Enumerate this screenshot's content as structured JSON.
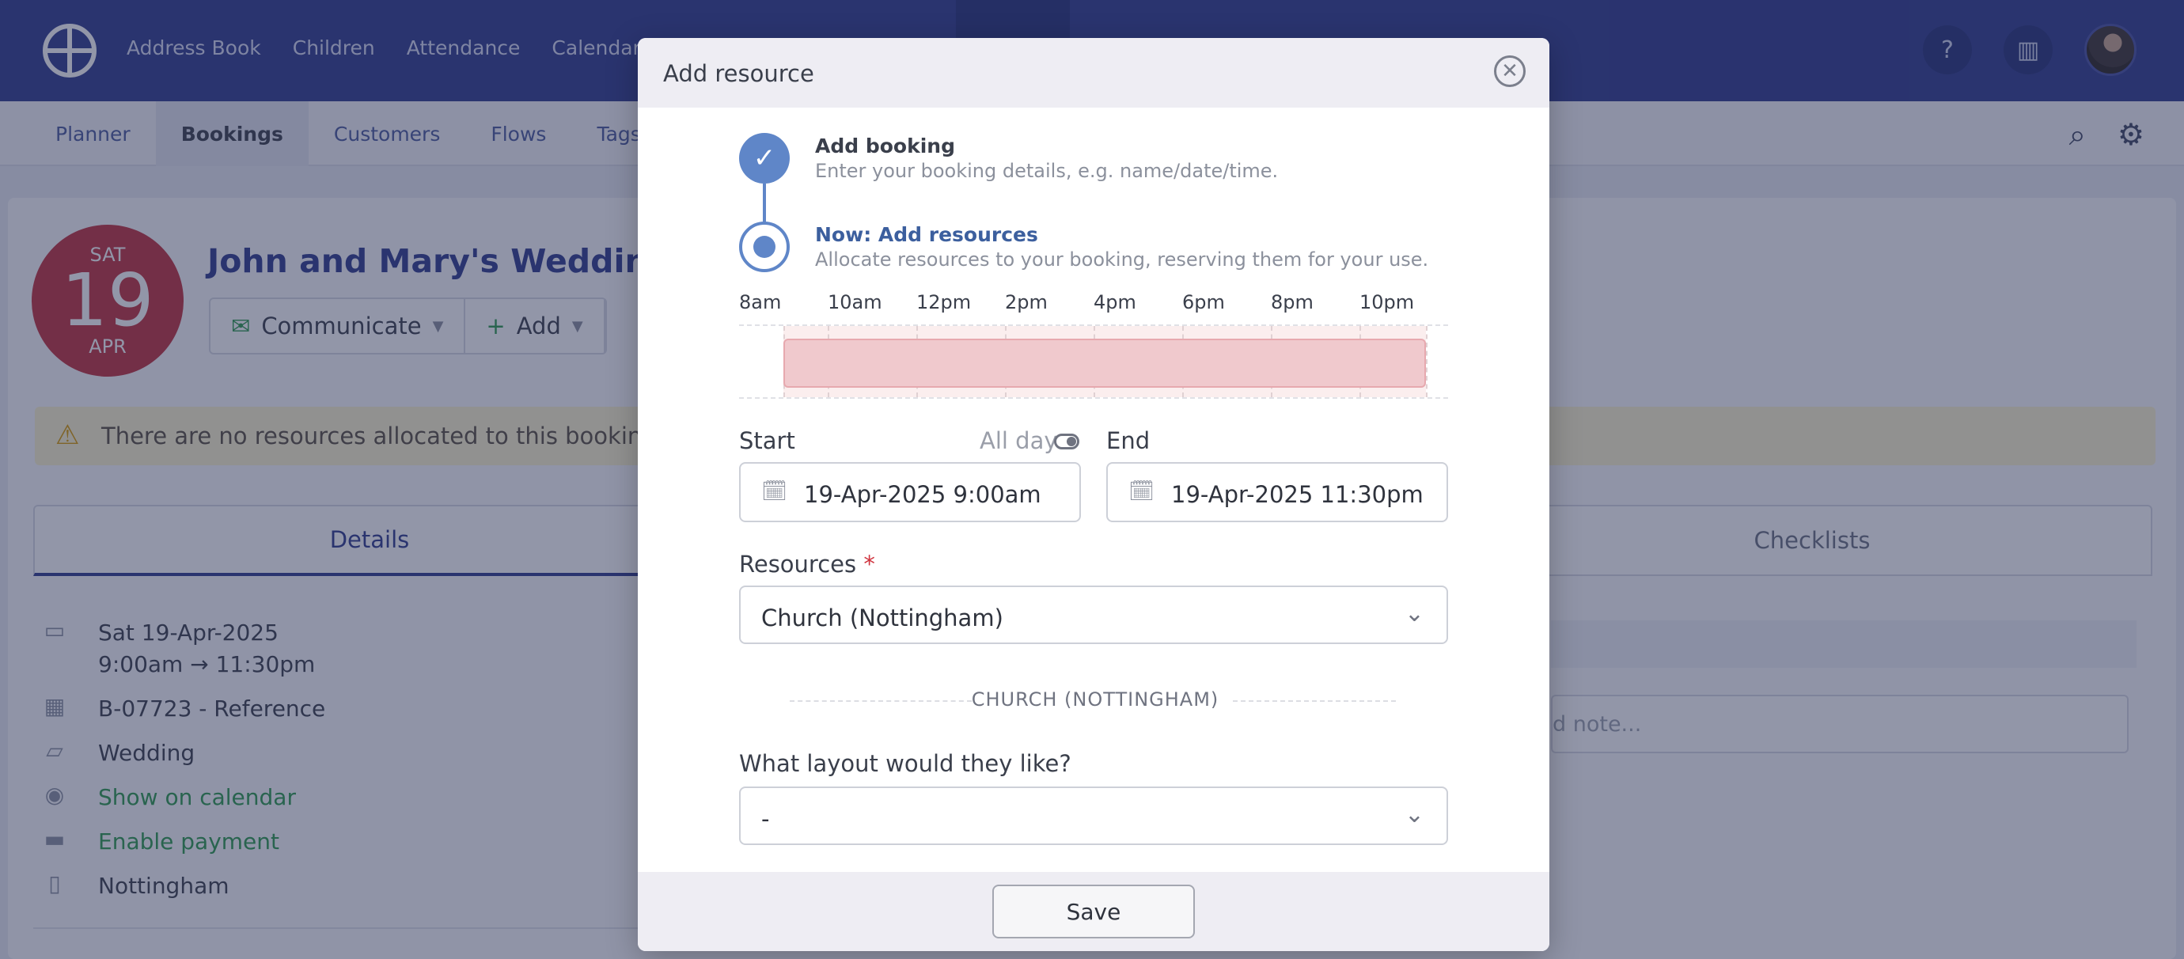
{
  "topnav": {
    "items": [
      "Address Book",
      "Children",
      "Attendance",
      "Calendar"
    ],
    "icons": [
      "help-icon",
      "building-icon"
    ]
  },
  "subnav": {
    "items": [
      "Planner",
      "Bookings",
      "Customers",
      "Flows",
      "Tags"
    ],
    "active": "Bookings"
  },
  "booking": {
    "date_weekday": "SAT",
    "date_day": "19",
    "date_month": "APR",
    "title": "John and Mary's Wedding",
    "actions": {
      "communicate": "Communicate",
      "add": "Add"
    },
    "alert": "There are no resources allocated to this booking. Ad",
    "tabs": {
      "details": "Details",
      "checklists": "Checklists"
    },
    "details": {
      "date": "Sat 19-Apr-2025",
      "time": "9:00am  →  11:30pm",
      "reference": "B-07723 - Reference",
      "category": "Wedding",
      "calendar": "Show on calendar",
      "payment": "Enable payment",
      "location": "Nottingham"
    },
    "note_placeholder": "d note..."
  },
  "modal": {
    "title": "Add resource",
    "steps": [
      {
        "title": "Add booking",
        "desc": "Enter your booking details, e.g. name/date/time."
      },
      {
        "title": "Now: Add resources",
        "desc": "Allocate resources to your booking, reserving them for your use."
      }
    ],
    "timeline": {
      "labels": [
        "8am",
        "10am",
        "12pm",
        "2pm",
        "4pm",
        "6pm",
        "8pm",
        "10pm"
      ],
      "range_start_hour": 8,
      "range_end_hour": 24,
      "booking_start_hour": 9,
      "booking_end_hour": 23.5,
      "bar_color": "#f0c9cd"
    },
    "form": {
      "start_label": "Start",
      "allday_label": "All day",
      "end_label": "End",
      "start_value": "19-Apr-2025 9:00am",
      "end_value": "19-Apr-2025 11:30pm",
      "resources_label": "Resources",
      "required_mark": "*",
      "resources_value": "Church (Nottingham)",
      "section_header": "CHURCH (NOTTINGHAM)",
      "layout_label": "What layout would they like?",
      "layout_value": "-"
    },
    "save_label": "Save"
  }
}
